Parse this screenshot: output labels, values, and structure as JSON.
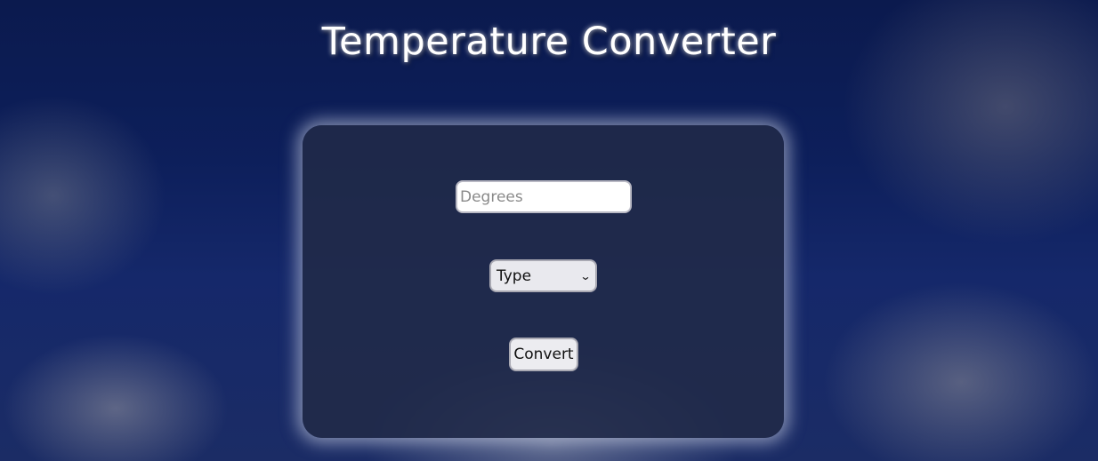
{
  "header": {
    "title": "Temperature Converter"
  },
  "form": {
    "degrees_placeholder": "Degrees",
    "degrees_value": "",
    "type_selected": "Type",
    "convert_label": "Convert"
  },
  "icons": {
    "select_arrow": "chevron-down-icon"
  },
  "colors": {
    "background": "#0d1f5b",
    "card": "#212a48",
    "title_text": "#ffffff",
    "card_glow": "#dce1f0"
  }
}
